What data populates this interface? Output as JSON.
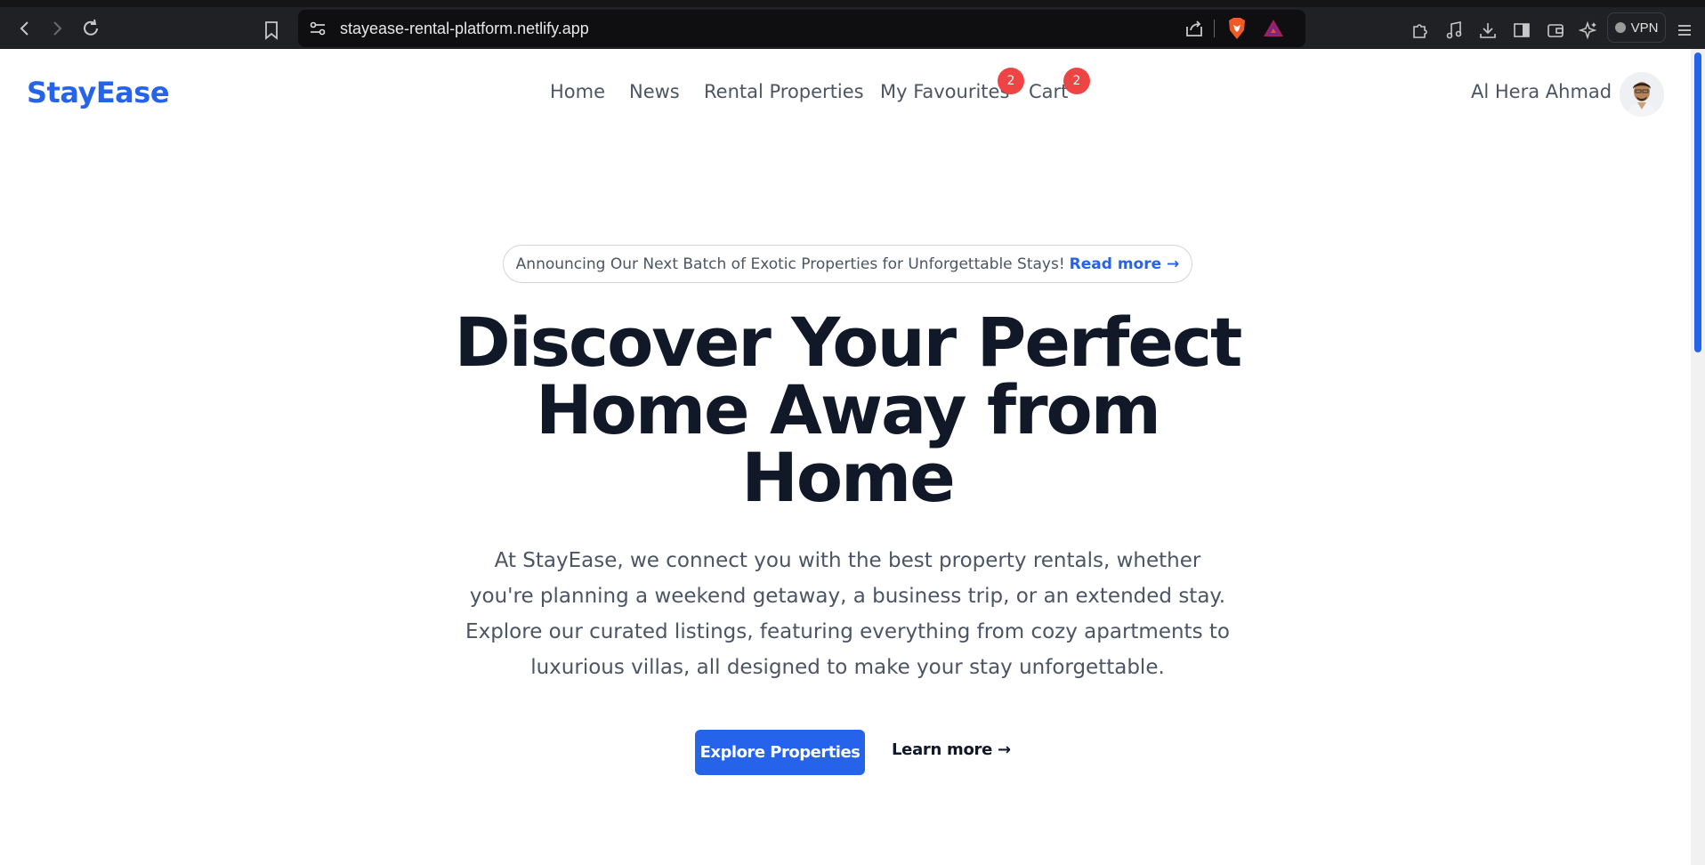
{
  "browser": {
    "url": "stayease-rental-platform.netlify.app",
    "vpn_label": "VPN"
  },
  "header": {
    "logo": "StayEase",
    "nav": [
      {
        "label": "Home"
      },
      {
        "label": "News"
      },
      {
        "label": "Rental Properties"
      },
      {
        "label": "My Favourites",
        "badge": "2"
      },
      {
        "label": "Cart",
        "badge": "2"
      }
    ],
    "user_name": "Al Hera Ahmad"
  },
  "hero": {
    "announcement": "Announcing Our Next Batch of Exotic Properties for Unforgettable Stays!",
    "read_more": "Read more →",
    "title_line1": "Discover Your Perfect",
    "title_line2": "Home Away from",
    "title_line3": "Home",
    "description": "At StayEase, we connect you with the best property rentals, whether you're planning a weekend getaway, a business trip, or an extended stay. Explore our curated listings, featuring everything from cozy apartments to luxurious villas, all designed to make your stay unforgettable.",
    "primary_button": "Explore Properties",
    "secondary_link": "Learn more →"
  },
  "colors": {
    "accent": "#2563eb",
    "badge": "#ef4444",
    "heading": "#111827",
    "body_text": "#4b5563"
  }
}
